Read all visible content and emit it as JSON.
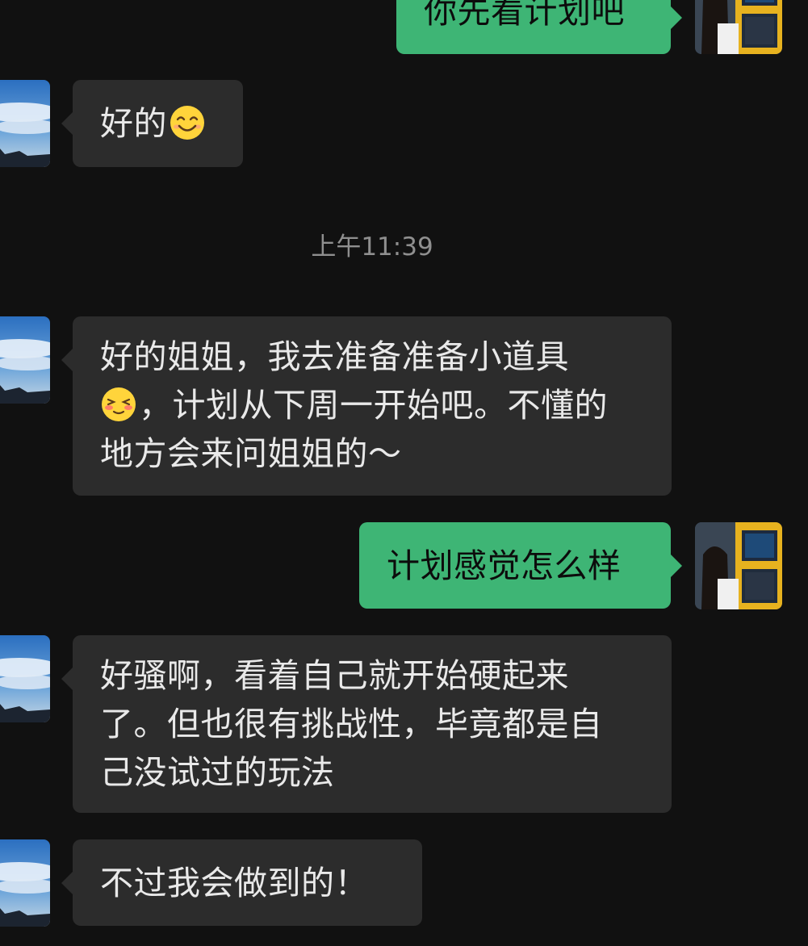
{
  "chat": {
    "messages": [
      {
        "id": "m1",
        "sender": "me",
        "lines": [
          "你先看计划吧"
        ]
      },
      {
        "id": "m2",
        "sender": "contact",
        "text": "好的",
        "emoji": "smiling-face-emoji"
      },
      {
        "id": "m3",
        "sender": "contact",
        "line1": "好的姐姐，我去准备准备小道具",
        "line2_emoji": "blushing-face-emoji",
        "line2_text": "，计划从下周一开始吧。不懂的",
        "line3": "地方会来问姐姐的～"
      },
      {
        "id": "m4",
        "sender": "me",
        "lines": [
          "计划感觉怎么样"
        ]
      },
      {
        "id": "m5",
        "sender": "contact",
        "lines": [
          "好骚啊，看着自己就开始硬起来",
          "了。但也很有挑战性，毕竟都是自",
          "己没试过的玩法"
        ]
      },
      {
        "id": "m6",
        "sender": "contact",
        "lines": [
          "不过我会做到的！"
        ]
      }
    ],
    "timestamp": "上午11:39"
  },
  "colors": {
    "background": "#111111",
    "incoming_bubble": "#2c2c2c",
    "outgoing_bubble": "#3eb575",
    "timestamp_text": "#8f8f8f"
  },
  "avatars": {
    "contact": "sky-avatar",
    "me": "girl-photo-avatar"
  }
}
